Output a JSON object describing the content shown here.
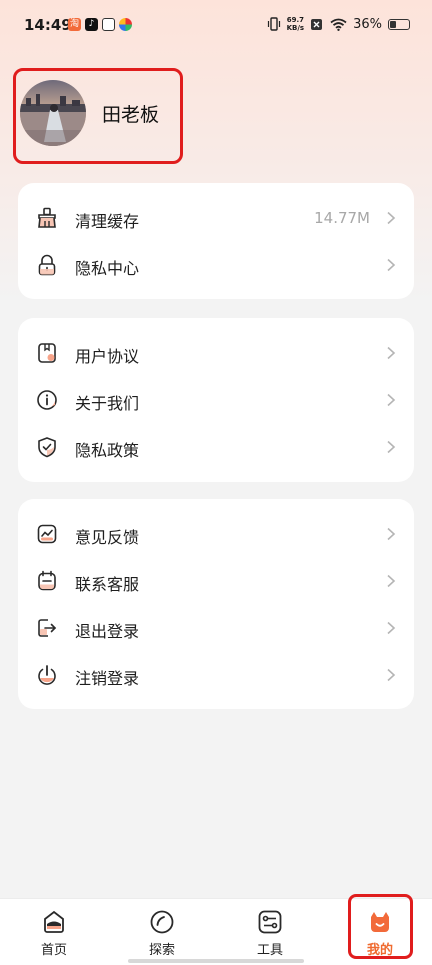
{
  "status_bar": {
    "time": "14:49",
    "net_speed_value": "69.7",
    "net_speed_unit": "KB/s",
    "battery": "36%",
    "battery_level": 0.36
  },
  "profile": {
    "name": "田老板"
  },
  "sections": [
    {
      "items": [
        {
          "label": "清理缓存",
          "value": "14.77M",
          "icon": "broom-icon"
        },
        {
          "label": "隐私中心",
          "icon": "lock-icon"
        }
      ]
    },
    {
      "items": [
        {
          "label": "用户协议",
          "icon": "agreement-icon"
        },
        {
          "label": "关于我们",
          "icon": "info-icon"
        },
        {
          "label": "隐私政策",
          "icon": "shield-icon"
        }
      ]
    },
    {
      "items": [
        {
          "label": "意见反馈",
          "icon": "feedback-icon"
        },
        {
          "label": "联系客服",
          "icon": "customer-service-icon"
        },
        {
          "label": "退出登录",
          "icon": "logout-icon"
        },
        {
          "label": "注销登录",
          "icon": "power-icon"
        }
      ]
    }
  ],
  "bottom_nav": {
    "items": [
      {
        "label": "首页",
        "icon": "home-icon"
      },
      {
        "label": "探索",
        "icon": "explore-icon"
      },
      {
        "label": "工具",
        "icon": "tools-icon"
      },
      {
        "label": "我的",
        "icon": "profile-icon",
        "active": true
      }
    ]
  },
  "colors": {
    "accent": "#ef6a2f",
    "highlight_border": "#e01d1d"
  }
}
